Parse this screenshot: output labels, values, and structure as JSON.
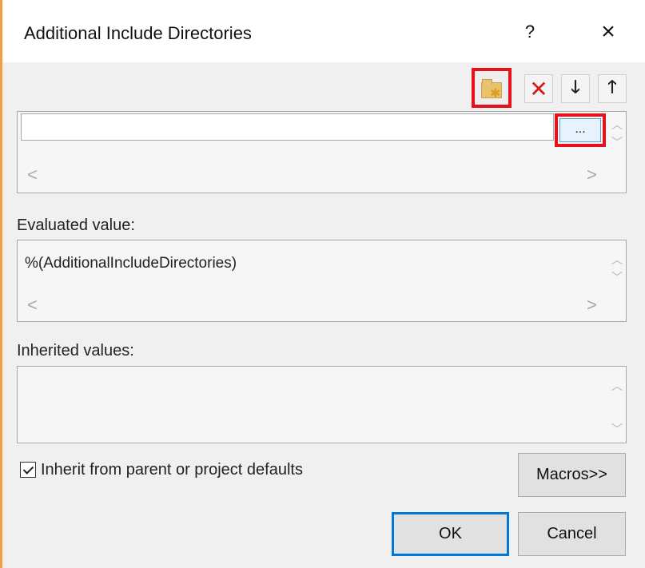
{
  "dialog": {
    "title": "Additional Include Directories",
    "help_label": "?",
    "close_label": "×"
  },
  "toolbar": {
    "new_line_icon": "new-folder-icon",
    "delete_label": "✕",
    "move_down_label": "🡓",
    "move_up_label": "🡑"
  },
  "editor": {
    "value": "",
    "browse_label": "..."
  },
  "evaluated": {
    "label": "Evaluated value:",
    "value": "%(AdditionalIncludeDirectories)"
  },
  "inherited": {
    "label": "Inherited values:"
  },
  "inherit_checkbox": {
    "label": "Inherit from parent or project defaults",
    "checked": true
  },
  "buttons": {
    "macros": "Macros>>",
    "ok": "OK",
    "cancel": "Cancel"
  },
  "scroll_glyphs": {
    "up": "︿",
    "down": "﹀",
    "left": "<",
    "right": ">"
  },
  "colors": {
    "highlight_red": "#e8101a",
    "focus_blue": "#0078d7",
    "delete_red": "#d21d1d",
    "window_stripe": "#f0a040"
  }
}
